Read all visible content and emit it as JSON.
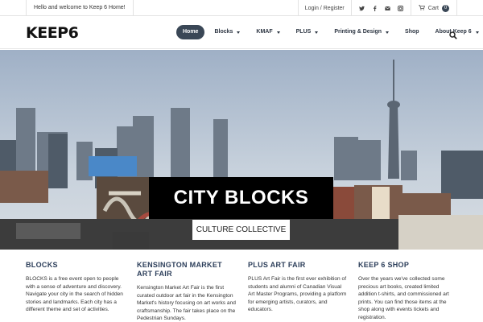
{
  "topbar": {
    "welcome": "Hello and welcome to Keep 6 Home!",
    "login": "Login / Register",
    "social_icons": [
      "twitter-icon",
      "facebook-icon",
      "email-icon",
      "instagram-icon"
    ],
    "cart_label": "Cart",
    "cart_count": "0"
  },
  "header": {
    "logo": "KEEP6",
    "nav": [
      {
        "label": "Home",
        "active": true
      },
      {
        "label": "Blocks",
        "dropdown": true
      },
      {
        "label": "KMAF",
        "dropdown": true
      },
      {
        "label": "PLUS",
        "dropdown": true
      },
      {
        "label": "Printing & Design",
        "dropdown": true
      },
      {
        "label": "Shop"
      },
      {
        "label": "About Keep 6",
        "dropdown": true
      }
    ]
  },
  "hero": {
    "title": "CITY BLOCKS",
    "subtitle": "CULTURE COLLECTIVE"
  },
  "columns": [
    {
      "title": "BLOCKS",
      "text": "BLOCKS is a free event open to people with a sense of adventure and discovery. Navigate your city in the search of hidden stories and landmarks. Each city has a different theme and set of activities."
    },
    {
      "title": "KENSINGTON MARKET ART FAIR",
      "text": "Kensington Market Art Fair is the first curated outdoor art fair in the Kensington Market's history focusing on art works and craftsmanship. The fair takes place on the Pedestrian Sundays."
    },
    {
      "title": "PLUS ART FAIR",
      "text": "PLUS Art Fair is the first ever exhibition of students and alumni of Canadian Visual Art Master Programs, providing a platform for emerging artists, curators, and educators."
    },
    {
      "title": "KEEP 6 SHOP",
      "text": "Over the years we've collected some precious art books, created limited addition t-shirts, and commissioned art prints. You can find those items at the shop along with events tickets and registration."
    }
  ],
  "colors": {
    "accent": "#3a4756",
    "heading": "#2c3e5a"
  }
}
